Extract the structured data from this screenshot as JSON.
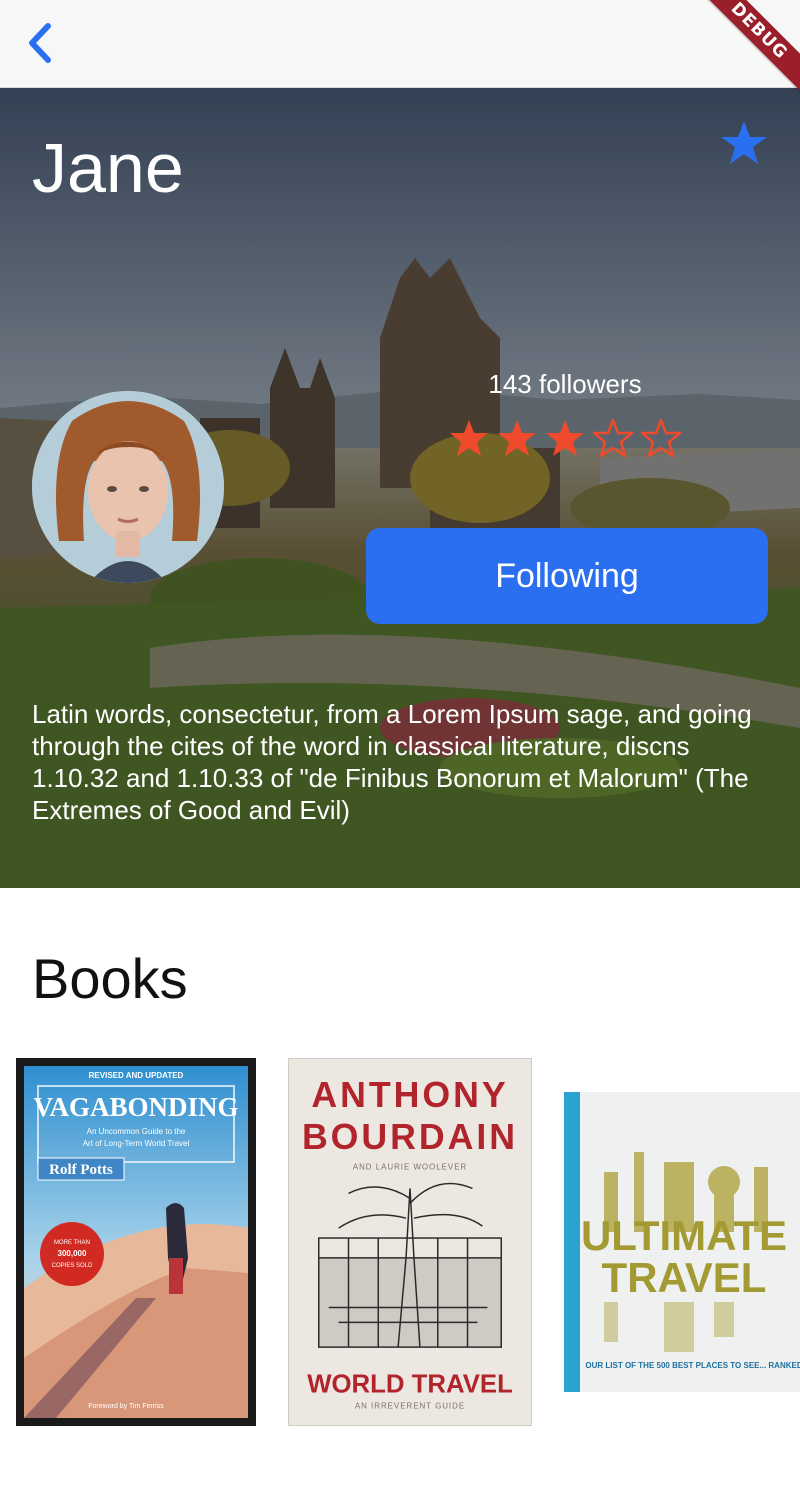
{
  "app": {
    "debug_banner": "DEBUG"
  },
  "profile": {
    "name": "Jane",
    "followers": "143 followers",
    "rating": 3,
    "rating_max": 5,
    "follow_button": "Following",
    "bio": "Latin words, consectetur, from a Lorem Ipsum sage, and going through the cites of the word in classical literature, discns 1.10.32 and 1.10.33 of \"de Finibus Bonorum et Malorum\" (The Extremes of Good and Evil)"
  },
  "books": {
    "heading": "Books",
    "items": [
      {
        "top_note": "REVISED AND UPDATED",
        "title": "VAGABONDING",
        "subtitle_line1": "An Uncommon Guide to the",
        "subtitle_line2": "Art of Long-Term World Travel",
        "author": "Rolf Potts",
        "badge_line1": "MORE THAN",
        "badge_line2": "300,000",
        "badge_line3": "COPIES SOLD",
        "foreword": "Foreword by Tim Ferriss"
      },
      {
        "title_line1": "ANTHONY",
        "title_line2": "BOURDAIN",
        "coauthor": "AND LAURIE WOOLEVER",
        "title_line3": "WORLD TRAVEL",
        "subtitle": "AN IRREVERENT GUIDE"
      },
      {
        "title_line1": "ULTIMATE",
        "title_line2": "TRAVEL",
        "tagline": "OUR LIST OF THE 500 BEST PLACES TO SEE... RANKED"
      }
    ]
  },
  "colors": {
    "accent": "#2a6ff0",
    "star_rating": "#f04a2c",
    "debug": "#9a1f2a"
  },
  "icons": {
    "back": "chevron-left-icon",
    "favorite": "star-filled-icon",
    "rating_full": "star-filled-icon",
    "rating_empty": "star-outline-icon"
  }
}
